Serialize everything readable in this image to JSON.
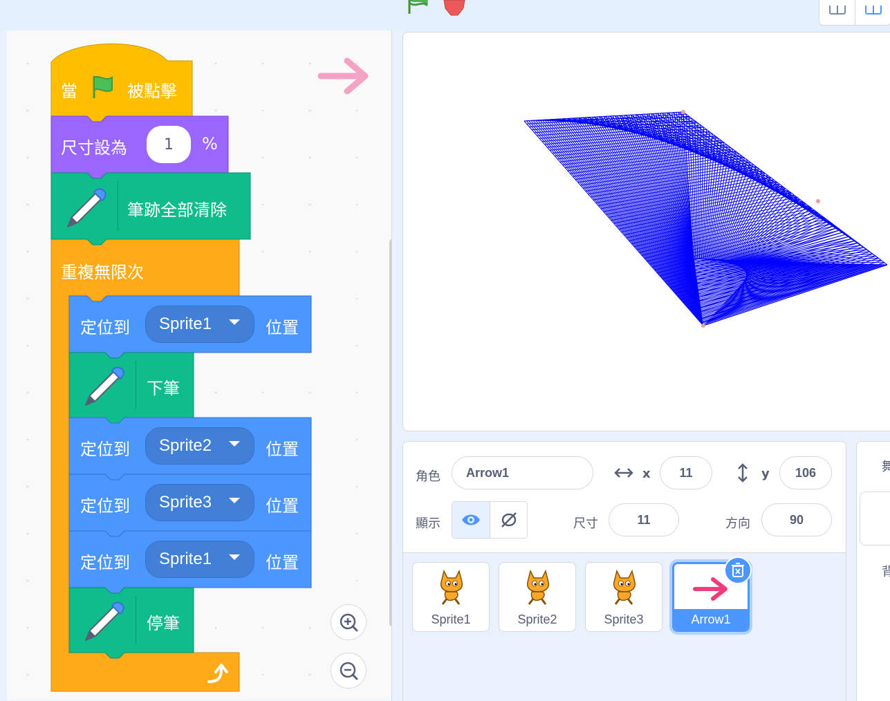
{
  "colors": {
    "events": "#ffbf00",
    "looks": "#9966ff",
    "pen": "#0fbd8c",
    "control": "#ffab19",
    "motion": "#4c97ff",
    "stage_drawing": "#0000ff",
    "selected": "#4c97ff",
    "arrow_pink": "#ee3d7a"
  },
  "scripts": {
    "hat": {
      "when": "當",
      "clicked": "被點擊",
      "flag_icon": "green-flag-icon"
    },
    "set_size": {
      "label": "尺寸設為",
      "value": "1",
      "unit": "%"
    },
    "clear": {
      "label": "筆跡全部清除"
    },
    "forever": {
      "label": "重複無限次"
    },
    "goto_1": {
      "label": "定位到",
      "target": "Sprite1",
      "suffix": "位置"
    },
    "pen_down": {
      "label": "下筆"
    },
    "goto_2": {
      "label": "定位到",
      "target": "Sprite2",
      "suffix": "位置"
    },
    "goto_3": {
      "label": "定位到",
      "target": "Sprite3",
      "suffix": "位置"
    },
    "goto_4": {
      "label": "定位到",
      "target": "Sprite1",
      "suffix": "位置"
    },
    "pen_up": {
      "label": "停筆"
    }
  },
  "sprite_info": {
    "sprite_label": "角色",
    "sprite_name": "Arrow1",
    "x_label": "x",
    "x_value": "11",
    "y_label": "y",
    "y_value": "106",
    "show_label": "顯示",
    "size_label": "尺寸",
    "size_value": "11",
    "direction_label": "方向",
    "direction_value": "90"
  },
  "sprites": [
    {
      "name": "Sprite1",
      "icon": "cat-icon"
    },
    {
      "name": "Sprite2",
      "icon": "cat-icon"
    },
    {
      "name": "Sprite3",
      "icon": "cat-icon"
    },
    {
      "name": "Arrow1",
      "icon": "arrow-icon",
      "selected": true
    }
  ],
  "backdrop": {
    "title_partial": "舞",
    "label_partial": "背"
  }
}
